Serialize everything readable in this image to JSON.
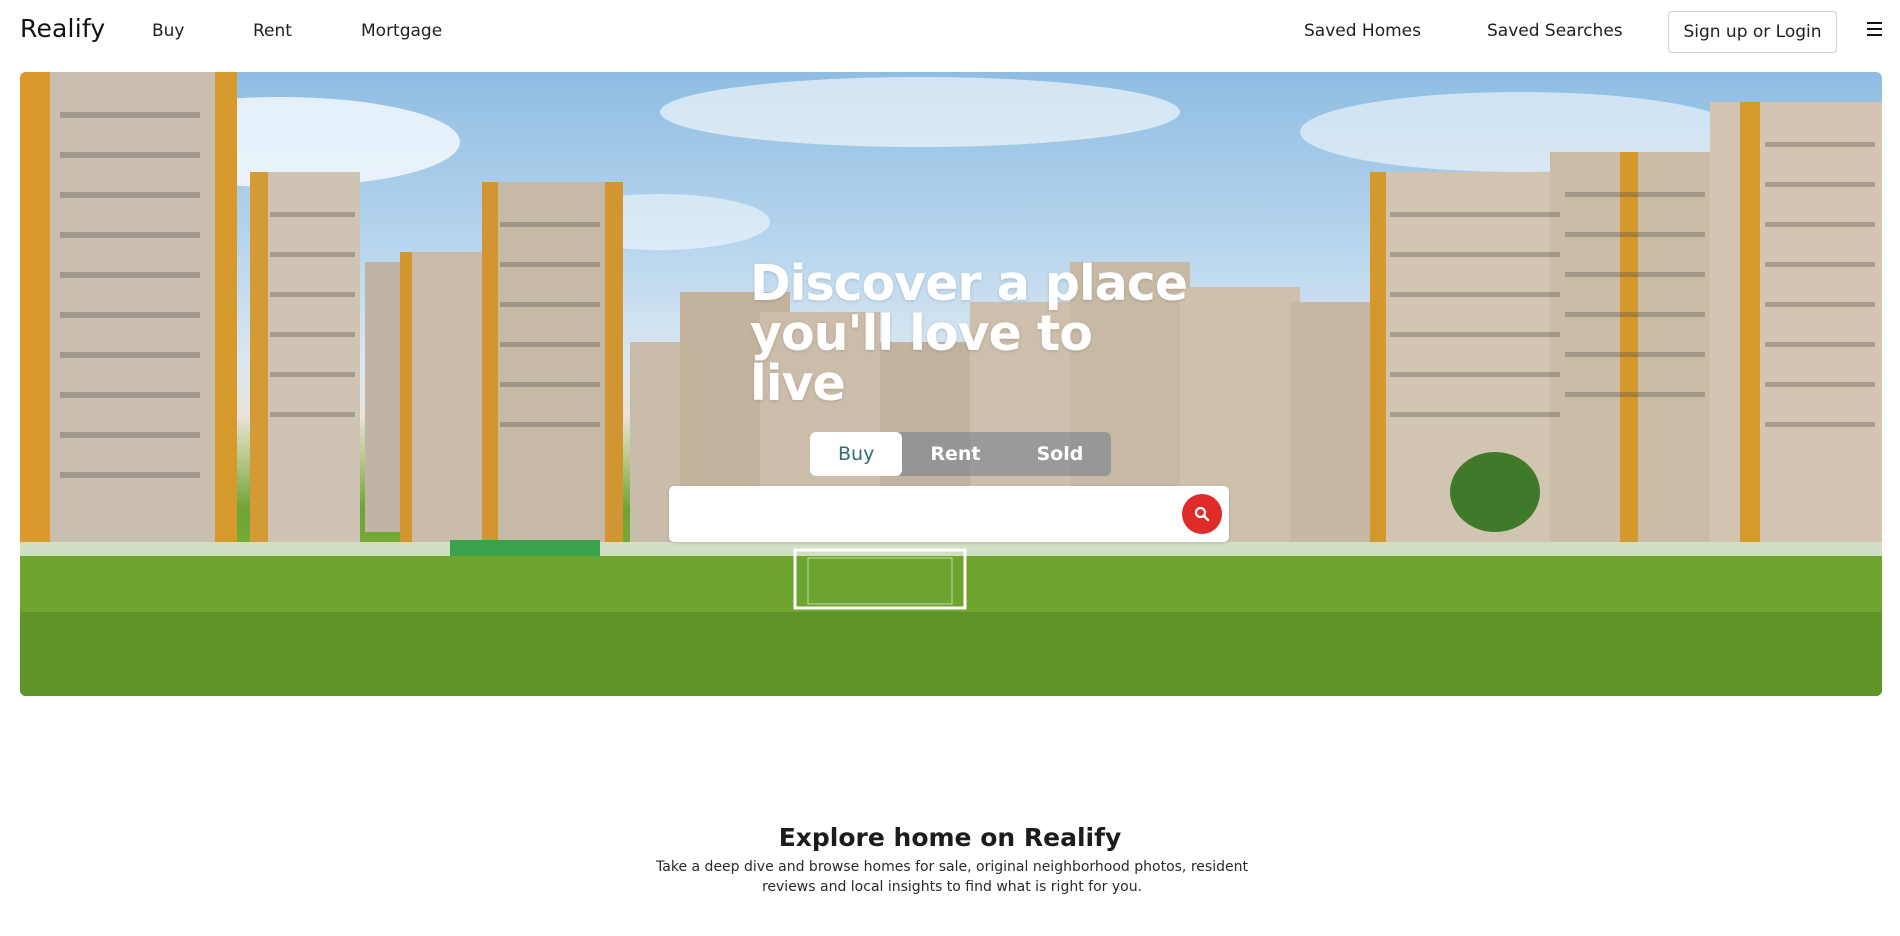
{
  "nav": {
    "logo": "Realify",
    "links": [
      {
        "label": "Buy"
      },
      {
        "label": "Rent"
      },
      {
        "label": "Mortgage"
      }
    ],
    "right_links": [
      {
        "label": "Saved Homes"
      },
      {
        "label": "Saved Searches"
      }
    ],
    "login_label": "Sign up or Login",
    "menu_icon": "hamburger-menu-icon"
  },
  "hero": {
    "title_line1": "Discover a place",
    "title_line2": "you'll love to live",
    "tabs": [
      {
        "label": "Buy",
        "active": true
      },
      {
        "label": "Rent",
        "active": false
      },
      {
        "label": "Sold",
        "active": false
      }
    ],
    "search": {
      "value": "",
      "placeholder": "",
      "button_icon": "search-icon"
    }
  },
  "explore": {
    "title": "Explore home on Realify",
    "description": "Take a deep dive and browse homes for sale, original neighborhood photos, resident reviews and local insights to find what is right for you."
  },
  "colors": {
    "accent_red": "#e02b2b",
    "active_tab_text": "#2f6f6f",
    "grass": "#6fa336",
    "sky": "#8fbde2"
  }
}
